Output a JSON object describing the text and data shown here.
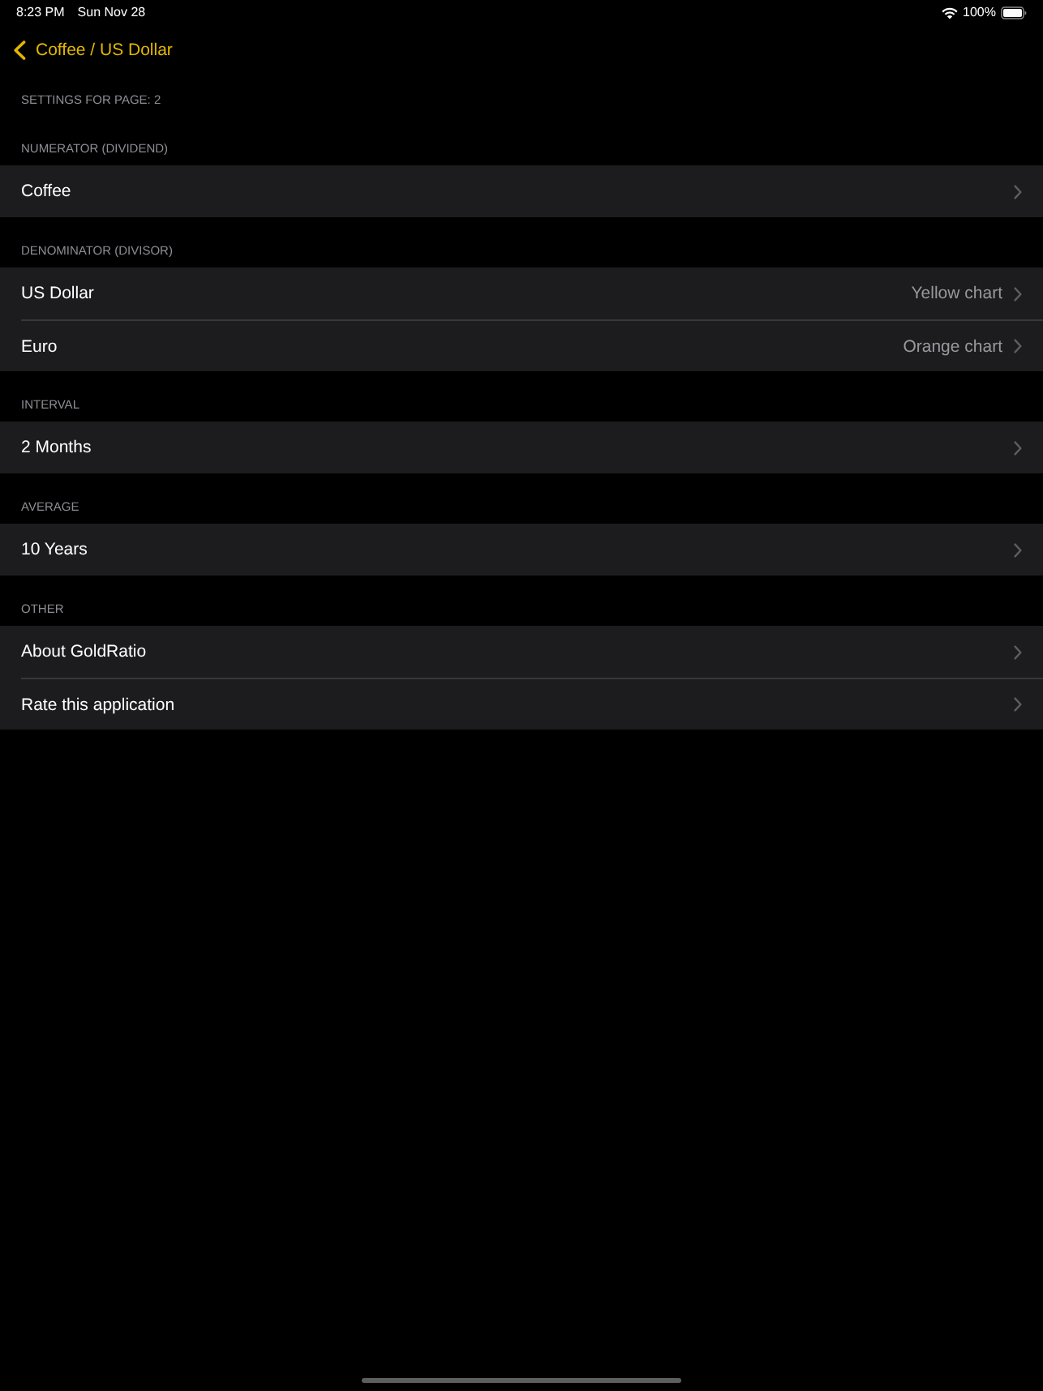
{
  "status_bar": {
    "time": "8:23 PM",
    "date": "Sun Nov 28",
    "battery": "100%"
  },
  "nav": {
    "back_title": "Coffee / US Dollar"
  },
  "page_caption": "SETTINGS FOR PAGE: 2",
  "sections": [
    {
      "header": "NUMERATOR (DIVIDEND)",
      "rows": [
        {
          "label": "Coffee"
        }
      ]
    },
    {
      "header": "DENOMINATOR (DIVISOR)",
      "rows": [
        {
          "label": "US Dollar",
          "value": "Yellow chart"
        },
        {
          "label": "Euro",
          "value": "Orange chart"
        }
      ]
    },
    {
      "header": "INTERVAL",
      "rows": [
        {
          "label": "2 Months"
        }
      ]
    },
    {
      "header": "AVERAGE",
      "rows": [
        {
          "label": "10 Years"
        }
      ]
    },
    {
      "header": "OTHER",
      "rows": [
        {
          "label": "About GoldRatio"
        },
        {
          "label": "Rate this application"
        }
      ]
    }
  ]
}
